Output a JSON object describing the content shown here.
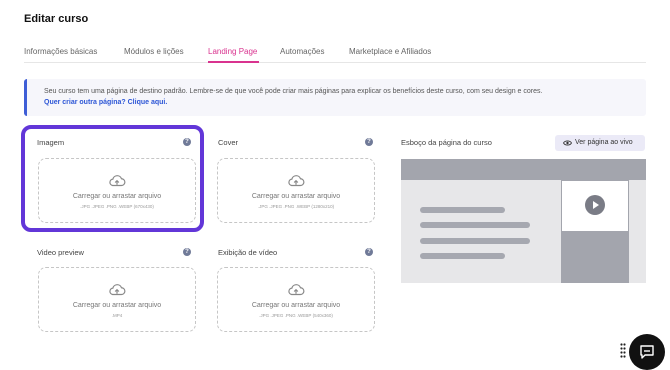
{
  "page": {
    "title": "Editar curso"
  },
  "tabs": [
    {
      "label": "Informações básicas",
      "active": false
    },
    {
      "label": "Módulos e lições",
      "active": false
    },
    {
      "label": "Landing Page",
      "active": true
    },
    {
      "label": "Automações",
      "active": false
    },
    {
      "label": "Marketplace e Afiliados",
      "active": false
    }
  ],
  "info": {
    "text": "Seu curso tem uma página de destino padrão. Lembre-se de que você pode criar mais páginas para explicar os benefícios deste curso, com seu design e cores.",
    "link": "Quer criar outra página? Clique aqui."
  },
  "uploads": {
    "image": {
      "label": "Imagem",
      "action": "Carregar ou arrastar arquivo",
      "hint": ".JPG .JPEG .PNG .WEBP (670x430)"
    },
    "cover": {
      "label": "Cover",
      "action": "Carregar ou arrastar arquivo",
      "hint": ".JPG .JPEG .PNG .WEBP (1280x210)"
    },
    "video_preview": {
      "label": "Video preview",
      "action": "Carregar ou arrastar arquivo",
      "hint": ".MP4"
    },
    "video_display": {
      "label": "Exibição de vídeo",
      "action": "Carregar ou arrastar arquivo",
      "hint": ".JPG .JPEG .PNG .WEBP (540x360)"
    }
  },
  "help_icon": "?",
  "preview": {
    "label": "Esboço da página do curso",
    "button_label": "Ver página ao vivo"
  },
  "colors": {
    "accent": "#d9338f",
    "link": "#2d56d6",
    "highlight": "#6236d8"
  }
}
